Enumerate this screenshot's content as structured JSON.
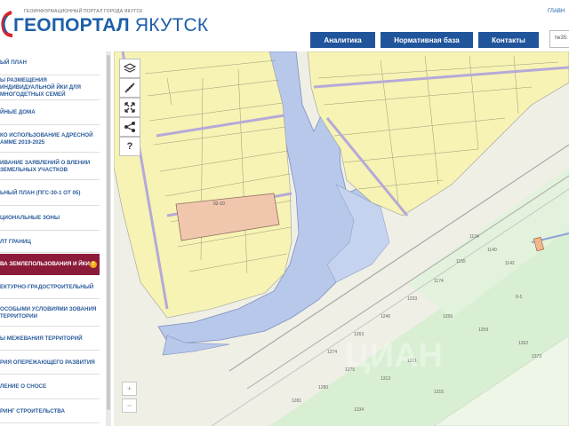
{
  "header": {
    "tagline": "ГЕОИНФОРМАЦИОННЫЙ ПОРТАЛ ГОРОДА ЯКУТСК",
    "logo_word1": "ГЕОПОРТАЛ",
    "logo_word2": "ЯКУТСК",
    "top_right_link": "ГЛАВН",
    "nav": {
      "analytics": "Аналитика",
      "normative": "Нормативная база",
      "contacts": "Контакты"
    },
    "search_value": "№35:"
  },
  "sidebar": {
    "items": [
      {
        "label": "ЫЙ ПЛАН"
      },
      {
        "label": "Ы РАЗМЕЩЕНИЯ ИНДИВИДУАЛЬНОЙ ЙКИ ДЛЯ МНОГОДЕТНЫХ СЕМЕЙ"
      },
      {
        "label": "ЙНЫЕ ДОМА"
      },
      {
        "label": "КО ИСПОЛЬЗОВАНИЕ АДРЕСНОЙ АММЕ 2019-2025"
      },
      {
        "label": "ИВАНИЕ ЗАЯВЛЕНИЙ О ВЛЕНИИ ЗЕМЕЛЬНЫХ УЧАСТКОВ"
      },
      {
        "label": "ЬНЫЙ ПЛАН (ПГС-30-1 ОТ 05)"
      },
      {
        "label": "ЦИОНАЛЬНЫЕ ЗОНЫ"
      },
      {
        "label": "ЛТ ГРАНИЦ"
      },
      {
        "label": "ВА ЗЕМЛЕПОЛЬЗОВАНИЯ И ЙКИ"
      },
      {
        "label": "ЕКТУРНО-ГРАДОСТРОИТЕЛЬНЫЙ"
      },
      {
        "label": "ОСОБЫМИ УСЛОВИЯМИ ЗОВАНИЯ ТЕРРИТОРИИ"
      },
      {
        "label": "Ы МЕЖЕВАНИЯ ТЕРРИТОРИЙ"
      },
      {
        "label": "РИЯ ОПЕРЕЖАЮЩЕГО РАЗВИТИЯ"
      },
      {
        "label": "ЛЕНИЕ О СНОСЕ"
      },
      {
        "label": "РИНГ СТРОИТЕЛЬСТВА"
      }
    ],
    "active_index": 8,
    "info_mark": "i"
  },
  "map": {
    "tools": {
      "layers": "layers-icon",
      "measure": "ruler-icon",
      "fullscreen": "fullscreen-icon",
      "share": "share-icon",
      "help": "?"
    },
    "zoom_in": "+",
    "zoom_out": "−",
    "parcel_label_main": "02-10",
    "parcel_label_right": "0-1",
    "watermark": "ЦИАН",
    "parcel_numbers": [
      "1134",
      "1140",
      "1142",
      "1155",
      "1174",
      "1233",
      "1240",
      "1256",
      "1259",
      "1262",
      "1263",
      "1274",
      "1275",
      "1280",
      "1281",
      "1311",
      "1313",
      "1315",
      "1334",
      "1373"
    ]
  },
  "colors": {
    "brand_blue": "#21559b",
    "active_item": "#8c1b3a",
    "info_dot": "#f2a814",
    "parcel_yellow": "#f6f3b4",
    "parcel_selected": "#f0c7ad",
    "water_blue": "#b7c8ea",
    "green_zone": "#d9efd3"
  }
}
